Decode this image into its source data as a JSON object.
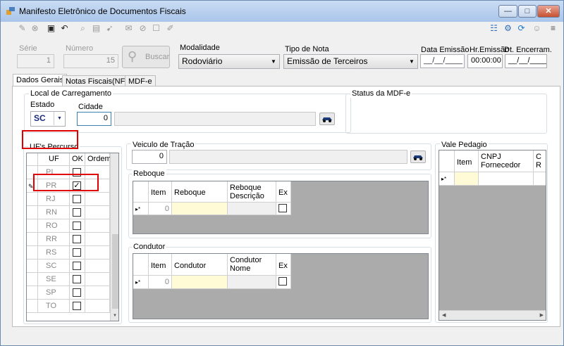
{
  "window": {
    "title": "Manifesto Eletrônico de Documentos Fiscais",
    "min": "—",
    "max": "□",
    "close": "✕"
  },
  "toolbar": {
    "left_icons": [
      "edit-icon",
      "cancel-icon",
      "save-icon",
      "undo-icon",
      "search-doc-icon",
      "print-icon",
      "send-icon",
      "mail-icon",
      "block-icon",
      "report-icon"
    ],
    "right_icons": [
      "sitemap-icon",
      "settings-icon",
      "refresh-icon",
      "user-icon",
      "list-icon"
    ]
  },
  "header": {
    "serie_label": "Série",
    "serie_value": "1",
    "numero_label": "Número",
    "numero_value": "15",
    "buscar_label": "Buscar",
    "modalidade_label": "Modalidade",
    "modalidade_value": "Rodoviário",
    "tipo_nota_label": "Tipo de Nota",
    "tipo_nota_value": "Emissão de Terceiros",
    "data_emissao_label": "Data Emissão",
    "data_emissao_value": "__/__/____",
    "hr_emissao_label": "Hr.Emissão",
    "hr_emissao_value": "00:00:00",
    "dt_encerram_label": "Dt. Encerram.",
    "dt_encerram_value": "__/__/____"
  },
  "tabs": [
    {
      "label": "Dados Gerais"
    },
    {
      "label": "Notas Fiscais(NF-e)"
    },
    {
      "label": "MDF-e"
    }
  ],
  "local": {
    "title": "Local de Carregamento",
    "estado_label": "Estado",
    "estado_value": "SC",
    "cidade_label": "Cidade",
    "cidade_value": "0",
    "cidade_desc": ""
  },
  "status": {
    "title": "Status da MDF-e"
  },
  "ufs": {
    "title": "UF's Percurso",
    "headers": [
      "UF",
      "OK",
      "Ordem"
    ],
    "rows": [
      {
        "uf": "PI",
        "ok": ""
      },
      {
        "uf": "PR",
        "ok": "✓",
        "current": "✎"
      },
      {
        "uf": "RJ",
        "ok": ""
      },
      {
        "uf": "RN",
        "ok": ""
      },
      {
        "uf": "RO",
        "ok": ""
      },
      {
        "uf": "RR",
        "ok": ""
      },
      {
        "uf": "RS",
        "ok": ""
      },
      {
        "uf": "SC",
        "ok": ""
      },
      {
        "uf": "SE",
        "ok": ""
      },
      {
        "uf": "SP",
        "ok": ""
      },
      {
        "uf": "TO",
        "ok": ""
      }
    ]
  },
  "veiculo": {
    "title": "Veiculo de Tração",
    "value": "0"
  },
  "reboque": {
    "title": "Reboque",
    "headers": [
      "Item",
      "Reboque",
      "Reboque Descrição",
      "Ex"
    ],
    "new_row": {
      "marker": "▸*",
      "item": "0"
    }
  },
  "condutor": {
    "title": "Condutor",
    "headers": [
      "Item",
      "Condutor",
      "Condutor Nome",
      "Ex"
    ],
    "new_row": {
      "marker": "▸*",
      "item": "0"
    }
  },
  "vale": {
    "title": "Vale Pedagio",
    "headers": [
      "Item",
      "CNPJ Fornecedor",
      "C R"
    ],
    "new_row": {
      "marker": "▸*"
    }
  }
}
